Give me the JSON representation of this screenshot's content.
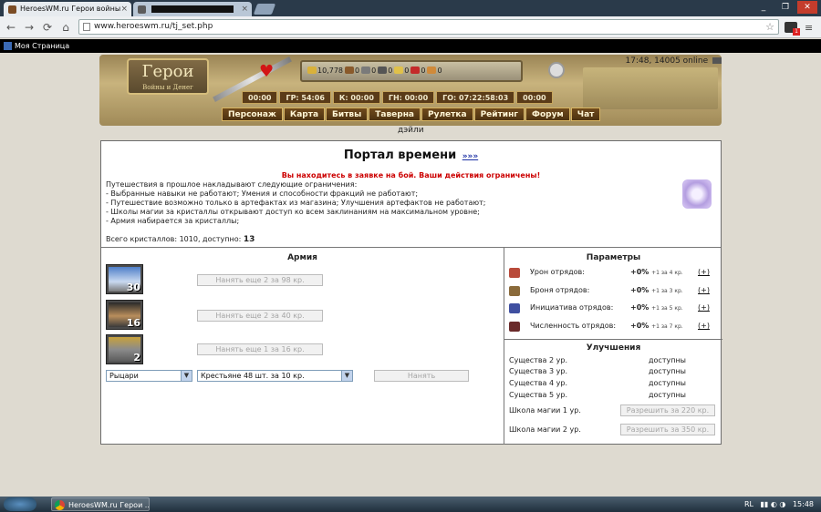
{
  "browser": {
    "tabs": [
      {
        "title": "HeroesWM.ru Герои войны",
        "close": "×"
      },
      {
        "title": "",
        "close": "×"
      }
    ],
    "window_buttons": [
      "_",
      "❐",
      "✕"
    ],
    "url": "www.heroeswm.ru/tj_set.php",
    "bookmark": "Моя Страница",
    "ext_badge": "1"
  },
  "header": {
    "logo_title": "Герои",
    "logo_subtitle": "Войны и Денег",
    "time_online": "17:48, 14005 online",
    "resources": [
      {
        "value": "10,778",
        "color": "#d9b13a"
      },
      {
        "value": "0",
        "color": "#8a5a2b"
      },
      {
        "value": "0",
        "color": "#7a7a7a"
      },
      {
        "value": "0",
        "color": "#555555"
      },
      {
        "value": "0",
        "color": "#e0c14a"
      },
      {
        "value": "0",
        "color": "#c42a2a"
      },
      {
        "value": "0",
        "color": "#d08a3a"
      }
    ],
    "timers": [
      "00:00",
      "ГР: 54:06",
      "К: 00:00",
      "ГН: 00:00",
      "ГО: 07:22:58:03",
      "00:00"
    ],
    "menu": [
      "Персонаж",
      "Карта",
      "Битвы",
      "Таверна",
      "Рулетка",
      "Рейтинг",
      "Форум",
      "Чат"
    ],
    "daily": "дэйли"
  },
  "portal": {
    "title": "Портал времени",
    "title_link": "»»»",
    "warning": "Вы находитесь в заявке на бой. Ваши действия ограничены!",
    "description": [
      "Путешествия в прошлое накладывают следующие ограничения:",
      "- Выбранные навыки не работают; Умения и способности фракций не работают;",
      "- Путешествие возможно только в артефактах из магазина; Улучшения артефактов не работают;",
      "- Школы магии за кристаллы открывают доступ ко всем заклинаниям на максимальном уровне;",
      "- Армия набирается за кристаллы;"
    ],
    "crystals_label": "Всего кристаллов: 1010, доступно:",
    "crystals_available": "13"
  },
  "army": {
    "title": "Армия",
    "units": [
      {
        "count": "30",
        "hire_label": "Нанять еще 2 за 98 кр."
      },
      {
        "count": "16",
        "hire_label": "Нанять еще 2 за 40 кр."
      },
      {
        "count": "2",
        "hire_label": "Нанять еще 1 за 16 кр."
      }
    ],
    "faction_select": "Рыцари",
    "creature_select": "Крестьяне 48 шт. за 10 кр.",
    "hire_button": "Нанять"
  },
  "params": {
    "title": "Параметры",
    "rows": [
      {
        "label": "Урон отрядов:",
        "value": "+0%",
        "cost": "+1 за 4 кр.",
        "plus": "(+)"
      },
      {
        "label": "Броня отрядов:",
        "value": "+0%",
        "cost": "+1 за 3 кр.",
        "plus": "(+)"
      },
      {
        "label": "Инициатива отрядов:",
        "value": "+0%",
        "cost": "+1 за 5 кр.",
        "plus": "(+)"
      },
      {
        "label": "Численность отрядов:",
        "value": "+0%",
        "cost": "+1 за 7 кр.",
        "plus": "(+)"
      }
    ]
  },
  "upgrades": {
    "title": "Улучшения",
    "rows": [
      {
        "label": "Существа 2 ур.",
        "value": "доступны"
      },
      {
        "label": "Существа 3 ур.",
        "value": "доступны"
      },
      {
        "label": "Существа 4 ур.",
        "value": "доступны"
      },
      {
        "label": "Существа 5 ур.",
        "value": "доступны"
      }
    ],
    "magic": [
      {
        "label": "Школа магии 1 ур.",
        "button": "Разрешить за 220 кр."
      },
      {
        "label": "Школа магии 2 ур.",
        "button": "Разрешить за 350 кр."
      }
    ]
  },
  "taskbar": {
    "task": "HeroesWM.ru Герои ...",
    "lang": "RL",
    "clock": "15:48"
  }
}
